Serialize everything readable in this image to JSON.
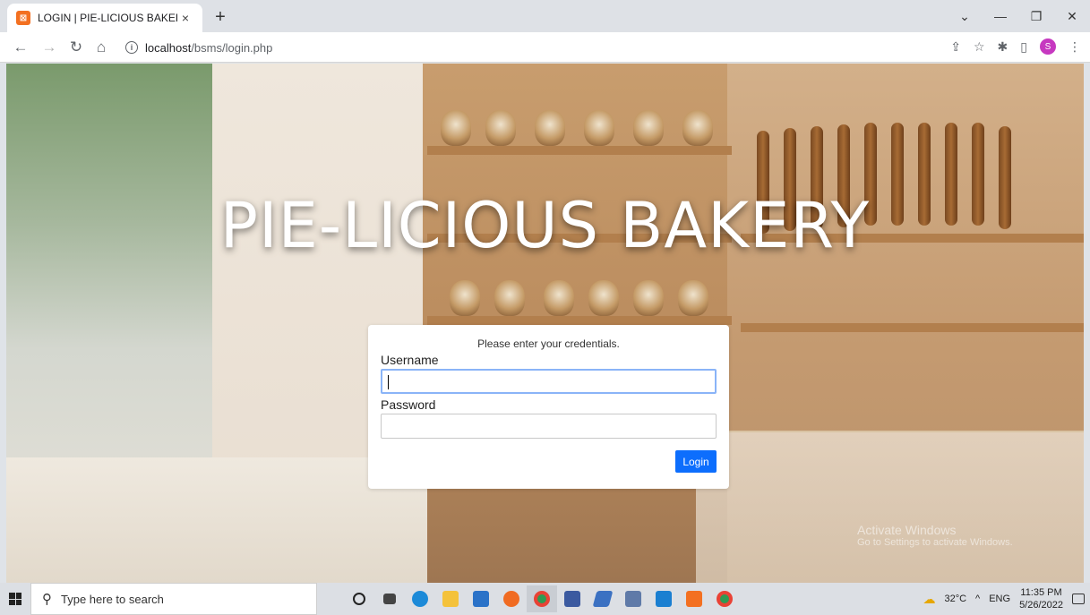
{
  "browser": {
    "tab_title": "LOGIN | PIE-LICIOUS BAKERY",
    "tab_close": "×",
    "new_tab": "+",
    "url_host": "localhost",
    "url_path": "/bsms/login.php",
    "controls": {
      "dropdown": "⌄",
      "minimize": "—",
      "restore": "❐",
      "close": "✕"
    },
    "profile_initial": "S"
  },
  "page": {
    "hero_title": "PIE-LICIOUS BAKERY",
    "login": {
      "message": "Please enter your credentials.",
      "username_label": "Username",
      "username_value": "",
      "password_label": "Password",
      "password_value": "",
      "submit_label": "Login"
    },
    "watermark": {
      "title": "Activate Windows",
      "subtitle": "Go to Settings to activate Windows."
    }
  },
  "taskbar": {
    "search_placeholder": "Type here to search",
    "apps": [
      "cortana-icon",
      "task-view-icon",
      "edge-icon",
      "file-explorer-icon",
      "store-icon",
      "firefox-icon",
      "chrome-icon",
      "notes-icon",
      "app-icon",
      "app-icon",
      "vscode-icon",
      "xampp-icon",
      "chrome-icon"
    ],
    "weather": "32°C",
    "language": "ENG",
    "time": "11:35 PM",
    "date": "5/26/2022"
  },
  "colors": {
    "accent": "#0d6efd",
    "tab_bar": "#dee1e6",
    "taskbar": "#dcdfe4"
  }
}
